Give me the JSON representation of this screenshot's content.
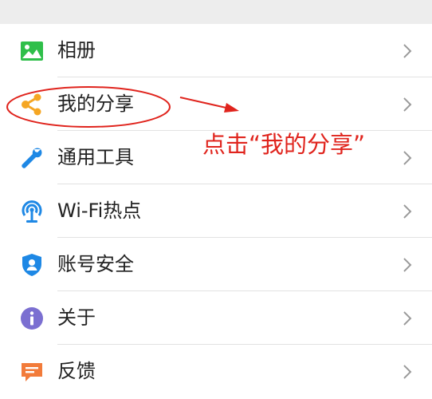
{
  "menu": {
    "items": [
      {
        "label": "相册",
        "icon": "photo-album-icon",
        "color": "#2fbf4a"
      },
      {
        "label": "我的分享",
        "icon": "share-icon",
        "color": "#f5a623"
      },
      {
        "label": "通用工具",
        "icon": "wrench-icon",
        "color": "#1e88e5"
      },
      {
        "label": "Wi-Fi热点",
        "icon": "wifi-hotspot-icon",
        "color": "#1e88e5"
      },
      {
        "label": "账号安全",
        "icon": "shield-user-icon",
        "color": "#1e88e5"
      },
      {
        "label": "关于",
        "icon": "info-icon",
        "color": "#7b6fd1"
      },
      {
        "label": "反馈",
        "icon": "feedback-icon",
        "color": "#f27b3a"
      }
    ]
  },
  "annotation": {
    "text": "点击“我的分享”",
    "color": "#e0241d"
  }
}
